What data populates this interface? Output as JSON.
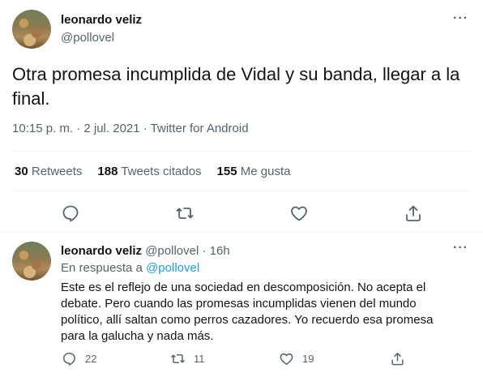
{
  "main_tweet": {
    "author_name": "leonardo veliz",
    "author_handle": "@pollovel",
    "text": "Otra promesa incumplida de Vidal y su banda, llegar a la final.",
    "meta": "10:15 p. m. · 2 jul. 2021 · Twitter for Android",
    "stats": {
      "retweets_count": "30",
      "retweets_label": "Retweets",
      "quotes_count": "188",
      "quotes_label": "Tweets citados",
      "likes_count": "155",
      "likes_label": "Me gusta"
    },
    "icons": [
      "reply-icon",
      "retweet-icon",
      "like-icon",
      "share-icon"
    ]
  },
  "reply_tweet": {
    "author_name": "leonardo veliz",
    "author_handle": "@pollovel",
    "time": "16h",
    "replying_prefix": "En respuesta a",
    "replying_to": "@pollovel",
    "text": "Este es el reflejo de una sociedad en descomposición. No acepta el debate. Pero cuando las promesas incumplidas vienen del mundo político, allí saltan como perros cazadores. Yo recuerdo esa promesa para la galucha y nada más.",
    "reply_count": "22",
    "retweet_count": "11",
    "like_count": "19"
  },
  "colors": {
    "text": "#0f1419",
    "secondary": "#536471",
    "link": "#1d9bf0",
    "divider": "#eff3f4"
  }
}
